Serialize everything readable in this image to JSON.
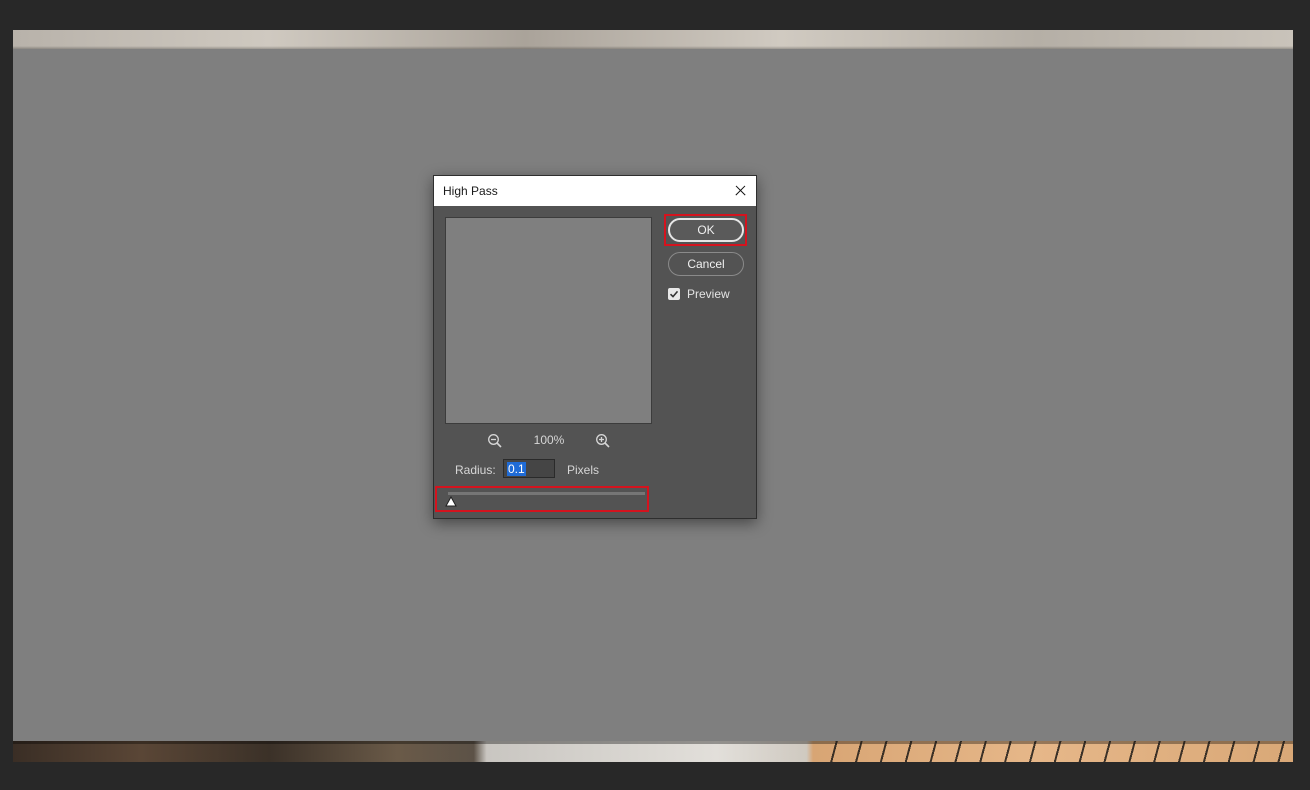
{
  "dialog": {
    "title": "High Pass",
    "zoom_level": "100%",
    "radius_label": "Radius:",
    "radius_value": "0.1",
    "units_label": "Pixels",
    "ok_label": "OK",
    "cancel_label": "Cancel",
    "preview_label": "Preview",
    "preview_checked": true,
    "slider_value_fraction": 0.0
  },
  "icons": {
    "close": "close-icon",
    "zoom_out": "zoom-out-icon",
    "zoom_in": "zoom-in-icon",
    "checkbox": "checkbox-checked-icon",
    "slider_thumb": "slider-triangle-icon"
  },
  "colors": {
    "canvas": "#7f7f7f",
    "dialog_bg": "#535353",
    "highlight_red": "#d4131e",
    "selection_blue": "#1f6bd6"
  }
}
